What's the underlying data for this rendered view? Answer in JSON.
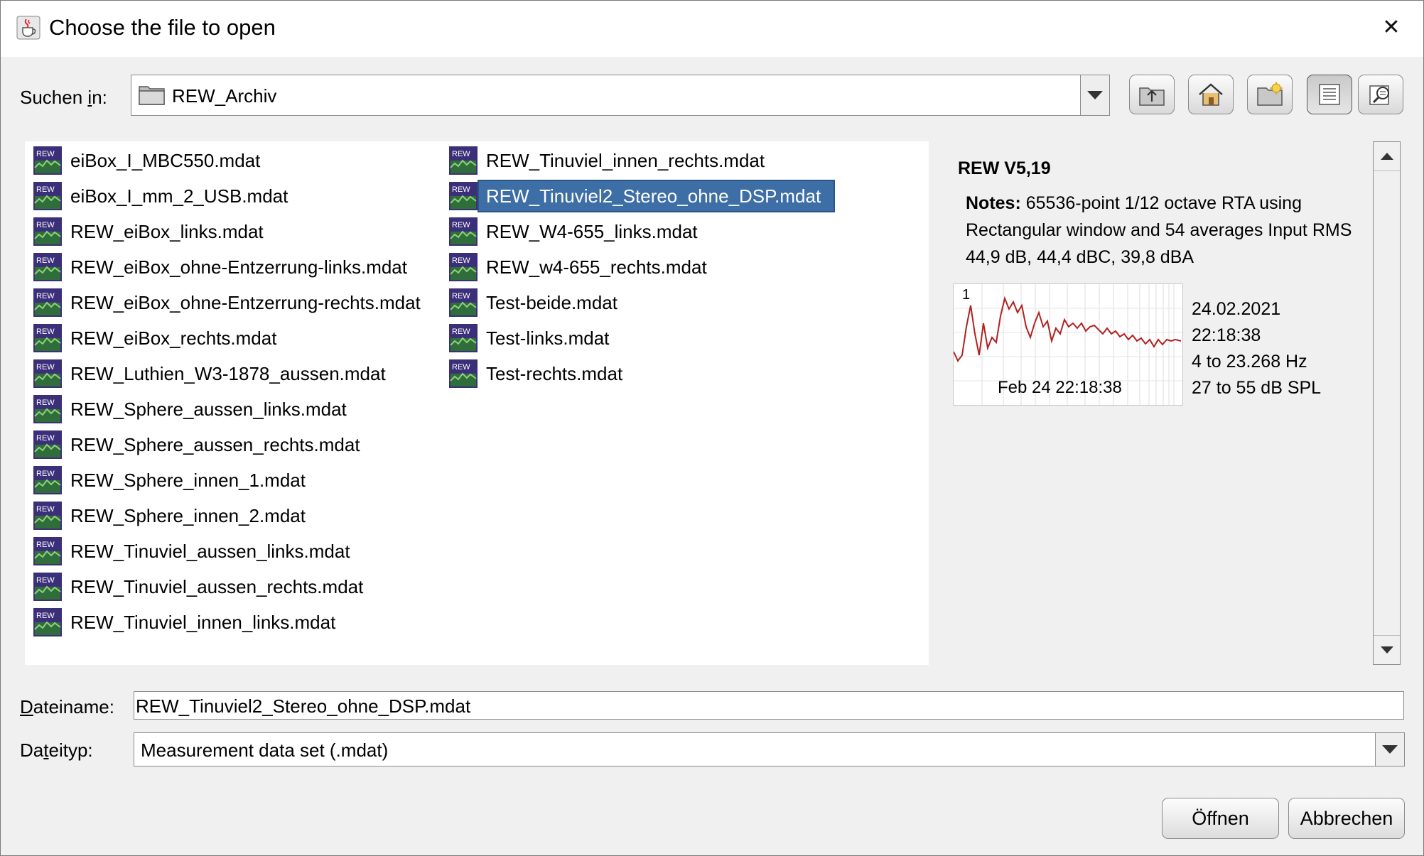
{
  "window": {
    "title": "Choose the file to open",
    "close_glyph": "✕",
    "icon": "java-cup-icon"
  },
  "lookin": {
    "label_pre": "Suchen ",
    "label_mnemonic": "i",
    "label_post": "n:",
    "value": "REW_Archiv"
  },
  "toolbar": {
    "buttons": [
      "up-folder-icon",
      "home-icon",
      "new-folder-icon",
      "list-view-icon",
      "details-view-icon"
    ],
    "pressed": "list-view-icon"
  },
  "files": [
    "eiBox_I_MBC550.mdat",
    "eiBox_I_mm_2_USB.mdat",
    "REW_eiBox_links.mdat",
    "REW_eiBox_ohne-Entzerrung-links.mdat",
    "REW_eiBox_ohne-Entzerrung-rechts.mdat",
    "REW_eiBox_rechts.mdat",
    "REW_Luthien_W3-1878_aussen.mdat",
    "REW_Sphere_aussen_links.mdat",
    "REW_Sphere_aussen_rechts.mdat",
    "REW_Sphere_innen_1.mdat",
    "REW_Sphere_innen_2.mdat",
    "REW_Tinuviel_aussen_links.mdat",
    "REW_Tinuviel_aussen_rechts.mdat",
    "REW_Tinuviel_innen_links.mdat",
    "REW_Tinuviel_innen_rechts.mdat",
    "REW_Tinuviel2_Stereo_ohne_DSP.mdat",
    "REW_W4-655_links.mdat",
    "REW_w4-655_rechts.mdat",
    "Test-beide.mdat",
    "Test-links.mdat",
    "Test-rechts.mdat"
  ],
  "selected_file": "REW_Tinuviel2_Stereo_ohne_DSP.mdat",
  "file_icon_text": "REW",
  "preview": {
    "version": "REW V5,19",
    "notes_label": "Notes:",
    "notes_text": " 65536-point 1/12 octave RTA using Rectangular window and 54 averages Input RMS 44,9 dB, 44,4 dBC, 39,8 dBA",
    "graph_number": "1",
    "graph_date": "Feb 24 22:18:38",
    "info": [
      "24.02.2021",
      "22:18:38",
      "4 to 23.268 Hz",
      "27 to 55 dB SPL"
    ],
    "trace_color": "#b22020"
  },
  "filename": {
    "label_mnemonic": "D",
    "label_rest": "ateiname:",
    "value": "REW_Tinuviel2_Stereo_ohne_DSP.mdat"
  },
  "filetype": {
    "label_pre": "Da",
    "label_mnemonic": "t",
    "label_post": "eityp:",
    "value": "Measurement data set (.mdat)"
  },
  "buttons": {
    "open": "Öffnen",
    "cancel": "Abbrechen"
  }
}
